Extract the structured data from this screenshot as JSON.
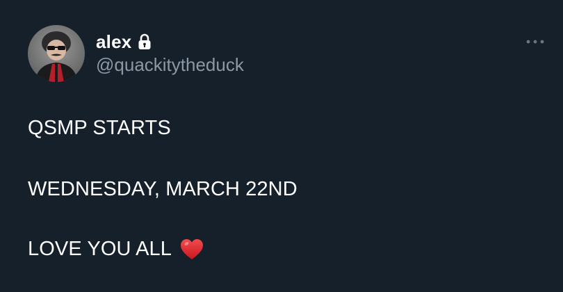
{
  "author": {
    "display_name": "alex",
    "handle": "@quackitytheduck",
    "protected_icon": "lock-icon",
    "avatar_icon": "profile-avatar"
  },
  "menu": {
    "more_icon": "more-horizontal-icon"
  },
  "tweet": {
    "line1": "QSMP STARTS",
    "line2": "WEDNESDAY, MARCH 22ND",
    "line3": "LOVE YOU ALL",
    "emoji_icon": "red-heart-icon"
  },
  "colors": {
    "background": "#15202b",
    "text_primary": "#ffffff",
    "text_secondary": "#8b98a5",
    "heart": "#e0242b"
  }
}
